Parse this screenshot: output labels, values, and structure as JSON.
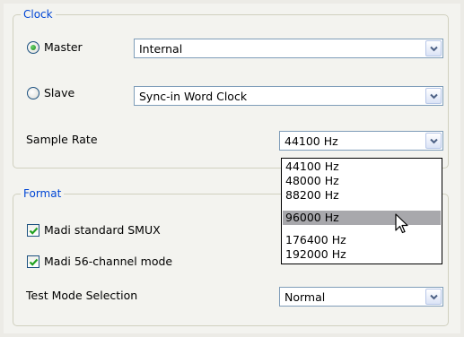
{
  "clock": {
    "title": "Clock",
    "master_label": "Master",
    "master_checked": true,
    "master_value": "Internal",
    "slave_label": "Slave",
    "slave_checked": false,
    "slave_value": "Sync-in Word Clock",
    "sample_rate_label": "Sample Rate",
    "sample_rate_value": "44100 Hz",
    "sample_rate_options": [
      "44100 Hz",
      "48000 Hz",
      "88200 Hz",
      "96000 Hz",
      "176400 Hz",
      "192000 Hz"
    ],
    "highlighted_option": "96000 Hz"
  },
  "format": {
    "title": "Format",
    "smux_label": "Madi standard SMUX",
    "smux_checked": true,
    "ch56_label": "Madi 56-channel mode",
    "ch56_checked": true,
    "test_mode_label": "Test Mode Selection",
    "test_mode_value": "Normal"
  },
  "colors": {
    "group_title": "#0046d5",
    "check_mark": "#21a121",
    "radio_dot": "#1e8e1e",
    "highlight": "#a8a8ac"
  },
  "icons": {
    "dropdown_arrow": "chevron-down-icon",
    "cursor": "mouse-pointer-icon"
  }
}
